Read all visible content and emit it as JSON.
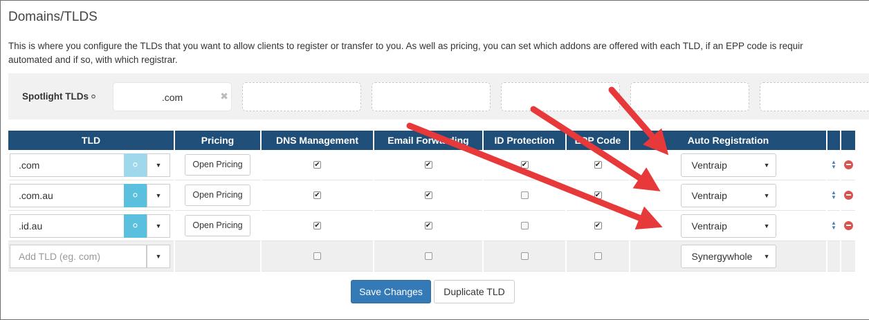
{
  "page": {
    "title": "Domains/TLDS",
    "intro_line1": "This is where you configure the TLDs that you want to allow clients to register or transfer to you. As well as pricing, you can set which addons are offered with each TLD, if an EPP code is requir",
    "intro_line2": "automated and if so, with which registrar."
  },
  "spotlight": {
    "label": "Spotlight TLDs",
    "icon": "lightbulb-icon",
    "slots": [
      ".com",
      "",
      "",
      "",
      "",
      ""
    ]
  },
  "table": {
    "headers": [
      "TLD",
      "Pricing",
      "DNS Management",
      "Email Forwarding",
      "ID Protection",
      "EPP Code",
      "Auto Registration"
    ],
    "rows": [
      {
        "tld": ".com",
        "pricing_label": "Open Pricing",
        "dns": true,
        "email": true,
        "idprot": true,
        "epp": true,
        "registrar": "Ventraip",
        "spotlighted": true
      },
      {
        "tld": ".com.au",
        "pricing_label": "Open Pricing",
        "dns": true,
        "email": true,
        "idprot": false,
        "epp": true,
        "registrar": "Ventraip",
        "spotlighted": false
      },
      {
        "tld": ".id.au",
        "pricing_label": "Open Pricing",
        "dns": true,
        "email": true,
        "idprot": false,
        "epp": true,
        "registrar": "Ventraip",
        "spotlighted": false
      }
    ],
    "add_row": {
      "placeholder": "Add TLD (eg. com)",
      "dns": false,
      "email": false,
      "idprot": false,
      "epp": false,
      "registrar": "Synergywhole"
    }
  },
  "buttons": {
    "save": "Save Changes",
    "duplicate": "Duplicate TLD"
  },
  "colors": {
    "header_bg": "#1f4e79",
    "primary": "#337ab7",
    "bulb_active": "#5bc0de",
    "annotation_arrow": "#e8393a",
    "remove": "#d9534f"
  }
}
